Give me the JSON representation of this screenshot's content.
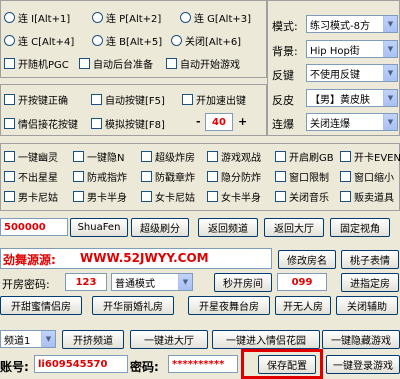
{
  "hotkeys": [
    {
      "label": "连 I[Alt+1]"
    },
    {
      "label": "连 P[Alt+2]"
    },
    {
      "label": "连 G[Alt+3]"
    },
    {
      "label": "连 C[Alt+4]"
    },
    {
      "label": "连 B[Alt+5]"
    },
    {
      "label": "关闭[Alt+6]"
    }
  ],
  "top_options": [
    "开随机PGC",
    "自动后台准备",
    "自动开始游戏"
  ],
  "settings": {
    "mode_label": "模式:",
    "mode_value": "练习模式-8方",
    "bg_label": "背景:",
    "bg_value": "Hip Hop街",
    "reverse_label": "反键",
    "reverse_value": "不使用反键",
    "skin_label": "反皮",
    "skin_value": "【男】黄皮肤",
    "combo_label": "连爆",
    "combo_value": "关闭连爆"
  },
  "mid_options": {
    "correct": "开按键正确",
    "auto_key": "自动按键[F5]",
    "speedup": "开加速出键",
    "couple": "情侣接花按键",
    "simulate": "模拟按键[F8]",
    "minus": "-",
    "speed": "40",
    "plus": "+"
  },
  "grid_options": [
    "一键幽灵",
    "一键隐N",
    "超级炸房",
    "游戏观战",
    "开启刷GB",
    "开卡EVENT",
    "不出星星",
    "防戒指炸",
    "防戳章炸",
    "隐分防炸",
    "窗口限制",
    "窗口缩小",
    "男卡尼姑",
    "男卡半身",
    "女卡尼姑",
    "女卡半身",
    "关闭音乐",
    "贩卖道具"
  ],
  "row1": {
    "value": "500000",
    "b1": "ShuaFen",
    "b2": "超级刷分",
    "b3": "返回频道",
    "b4": "返回大厅",
    "b5": "固定视角"
  },
  "row2": {
    "source_label": "劲舞源源:",
    "url": "WWW.52JWYY.COM",
    "b1": "修改房名",
    "b2": "桃子表情"
  },
  "row3": {
    "pwd_label": "开房密码:",
    "pwd": "123",
    "mode": "普通模式",
    "b1": "秒开房间",
    "room": "099",
    "b2": "进指定房"
  },
  "row4": {
    "b1": "开甜蜜情侣房",
    "b2": "开华丽婚礼房",
    "b3": "开星夜舞台房",
    "b4": "开无人房",
    "b5": "关闭辅助"
  },
  "row5": {
    "channel": "频道1",
    "b1": "开挤频道",
    "b2": "一键进大厅",
    "b3": "一键进入情侣花园",
    "b4": "一键隐藏游戏"
  },
  "row6": {
    "acct_label": "账号:",
    "acct": "li609545570",
    "pwd_label": "密码:",
    "pwd": "**********",
    "save": "保存配置",
    "login": "一键登录游戏"
  }
}
